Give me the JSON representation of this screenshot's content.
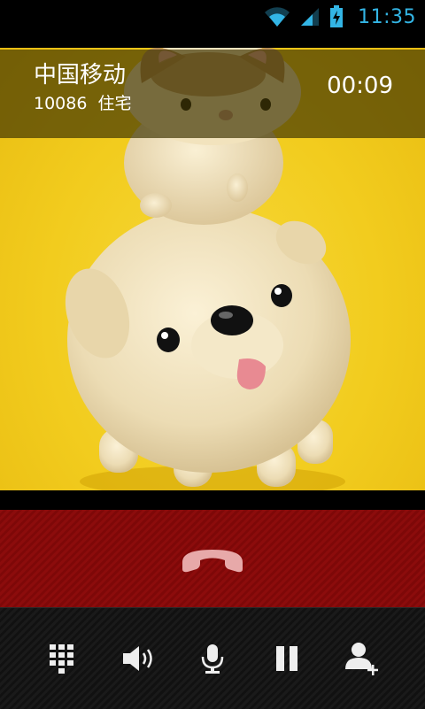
{
  "status_bar": {
    "time": "11:35",
    "icons": [
      "wifi-icon",
      "signal-icon",
      "battery-charging-icon"
    ],
    "accent_color": "#33b5e5"
  },
  "call": {
    "caller_name": "中国移动",
    "caller_number": "10086",
    "caller_label": "住宅",
    "duration": "00:09"
  },
  "end_call": {
    "icon": "end-call-icon",
    "color": "#8c0c0c"
  },
  "actions": [
    {
      "icon": "dialpad-icon"
    },
    {
      "icon": "speaker-icon"
    },
    {
      "icon": "mute-mic-icon"
    },
    {
      "icon": "hold-icon"
    },
    {
      "icon": "add-call-icon"
    }
  ]
}
